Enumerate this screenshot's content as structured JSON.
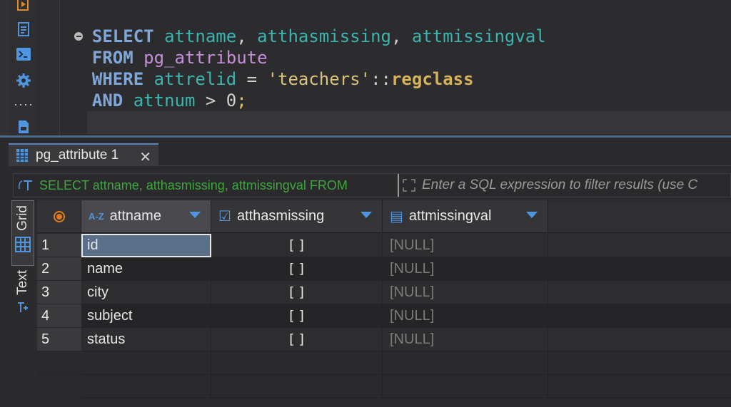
{
  "editor": {
    "lines": [
      {
        "kw": "SELECT",
        "cols": [
          "attname",
          "atthasmissing",
          "attmissingval"
        ]
      },
      {
        "kw": "FROM",
        "table": "pg_attribute"
      },
      {
        "kw": "WHERE",
        "ident": "attrelid",
        "op": "=",
        "str": "'teachers'",
        "cast": "::",
        "type": "regclass"
      },
      {
        "kw": "AND",
        "ident": "attnum",
        "op": ">",
        "num": "0",
        "semi": ";"
      }
    ]
  },
  "results": {
    "tab": {
      "title": "pg_attribute 1",
      "close": "✕"
    },
    "filter": {
      "query_text": "SELECT attname, atthasmissing, attmissingval FROM",
      "placeholder": "Enter a SQL expression to filter results (use C"
    },
    "side_tabs": {
      "grid": "Grid",
      "text": "Text"
    },
    "columns": [
      {
        "name": "attname",
        "type_badge": "A-Z"
      },
      {
        "name": "atthasmissing",
        "type_badge": "☑"
      },
      {
        "name": "attmissingval",
        "type_badge": "▤"
      }
    ],
    "rows": [
      {
        "n": "1",
        "attname": "id",
        "atthasmissing": "[ ]",
        "attmissingval": "[NULL]"
      },
      {
        "n": "2",
        "attname": "name",
        "atthasmissing": "[ ]",
        "attmissingval": "[NULL]"
      },
      {
        "n": "3",
        "attname": "city",
        "atthasmissing": "[ ]",
        "attmissingval": "[NULL]"
      },
      {
        "n": "4",
        "attname": "subject",
        "atthasmissing": "[ ]",
        "attmissingval": "[NULL]"
      },
      {
        "n": "5",
        "attname": "status",
        "atthasmissing": "[ ]",
        "attmissingval": "[NULL]"
      }
    ],
    "colors": {
      "accent": "#4f86c6",
      "sort": "#4f95e0",
      "marker": "#e07a1f",
      "query": "#3ea63e"
    }
  }
}
